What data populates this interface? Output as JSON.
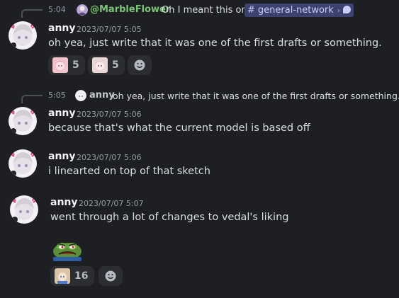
{
  "messages": {
    "m1": {
      "reply": {
        "time": "5:04",
        "author": "@MarbleFlower",
        "text": "Oh I meant this one",
        "channel": "general-network",
        "channel_hash": "#",
        "channel_chevron": "›"
      },
      "author": "anny",
      "timestamp": "2023/07/07 5:05",
      "text": "oh yea, just write that it was one of the first drafts or something.",
      "reactions": [
        {
          "emoji": "pink-anime-girl-emoji",
          "count": "5"
        },
        {
          "emoji": "anime-girl-emoji",
          "count": "5"
        }
      ]
    },
    "m2": {
      "reply": {
        "time": "5:05",
        "author": "anny",
        "text": "oh yea, just write that it was one of the first drafts or something."
      },
      "author": "anny",
      "timestamp": "2023/07/07 5:06",
      "text": "because that's what the current model is based off"
    },
    "m3": {
      "author": "anny",
      "timestamp": "2023/07/07 5:06",
      "text": "i linearted on top of that sketch"
    },
    "m4": {
      "author": "anny",
      "timestamp": "2023/07/07 5:07",
      "text": "went through a lot of changes to vedal's liking",
      "attachment": "angry-pepe-emoji",
      "reactions": [
        {
          "emoji": "anime-face-emoji",
          "count": "16"
        }
      ]
    }
  },
  "colors": {
    "background": "#1e1f23",
    "reply_author_green": "#7cc576",
    "channel_pill_bg": "#3c4270",
    "reaction_bg": "#2b2d31"
  },
  "icons": {
    "add_reaction": "smiley-add-icon",
    "thread": "speech-bubble-icon"
  }
}
